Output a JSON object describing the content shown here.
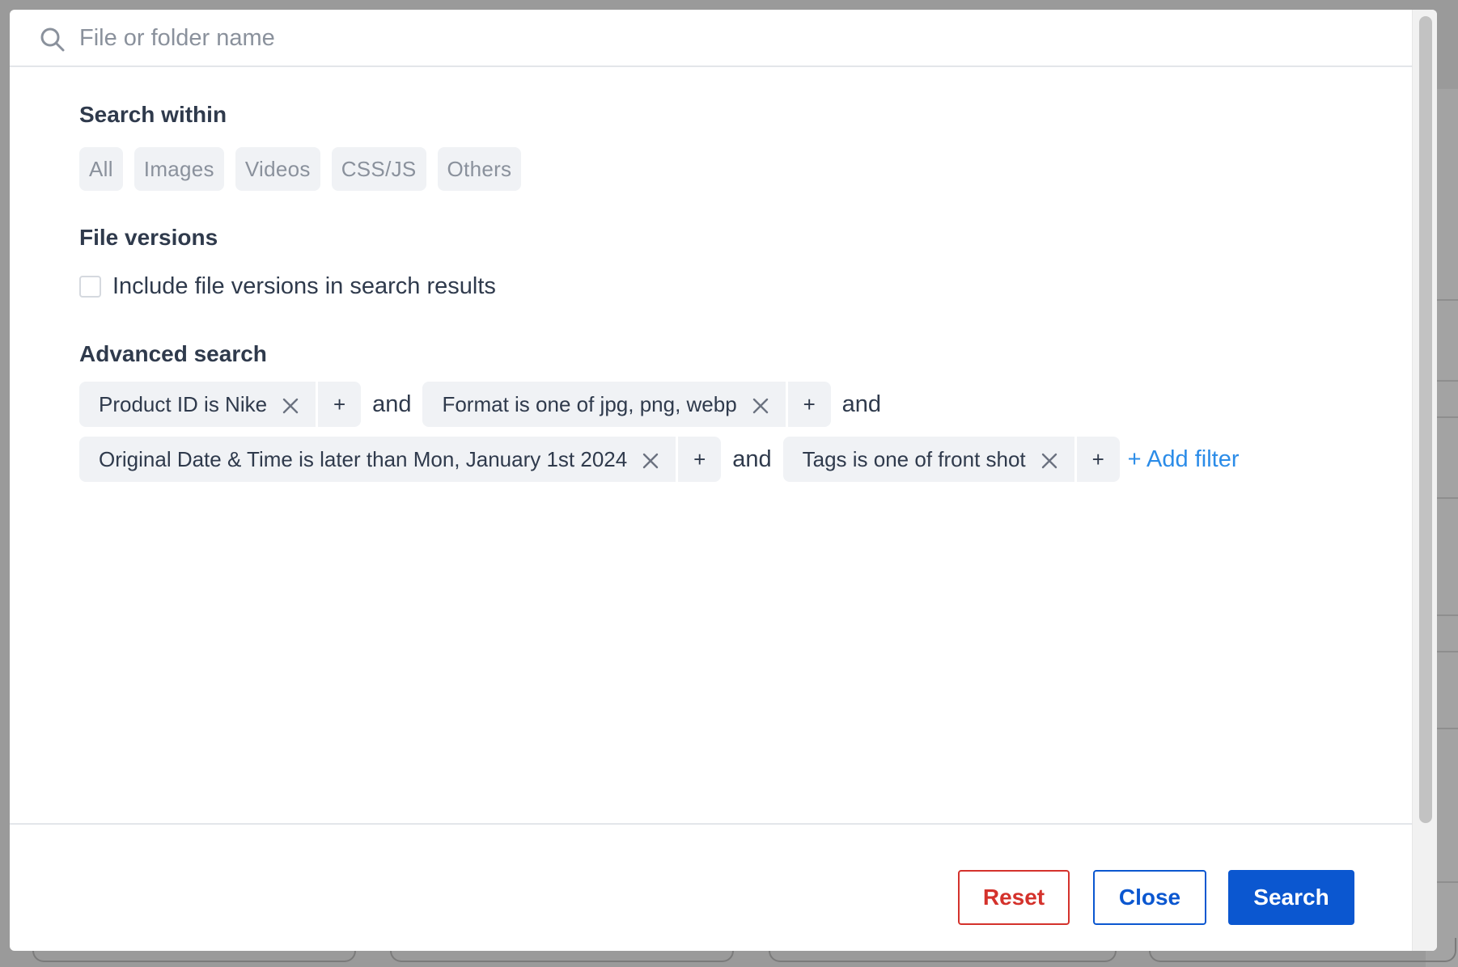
{
  "search": {
    "placeholder": "File or folder name",
    "value": ""
  },
  "search_within": {
    "title": "Search within",
    "options": [
      "All",
      "Images",
      "Videos",
      "CSS/JS",
      "Others"
    ]
  },
  "file_versions": {
    "title": "File versions",
    "checkbox_label": "Include file versions in search results",
    "checked": false
  },
  "advanced_search": {
    "title": "Advanced search",
    "filters": [
      {
        "label": "Product ID is Nike"
      },
      {
        "label": "Format is one of jpg, png, webp"
      },
      {
        "label": "Original Date & Time is later than Mon, January 1st 2024"
      },
      {
        "label": "Tags is one of front shot"
      }
    ],
    "plus_label": "+",
    "connector": "and",
    "add_filter_label": "+ Add filter"
  },
  "footer": {
    "reset_label": "Reset",
    "close_label": "Close",
    "search_label": "Search"
  },
  "colors": {
    "primary": "#0b57d0",
    "danger": "#d4322c",
    "link": "#2b8ce8",
    "chip_bg": "#f0f2f5"
  }
}
